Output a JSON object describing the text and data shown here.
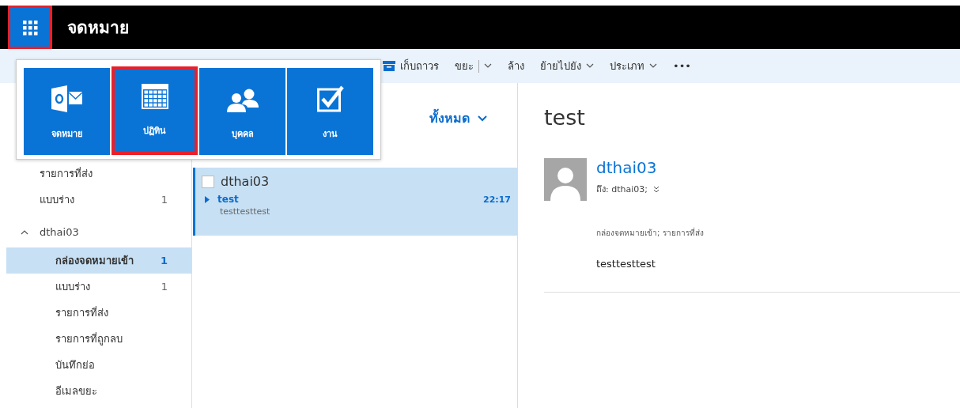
{
  "app_launcher": {
    "highlighted": true
  },
  "header": {
    "title": "จดหมาย"
  },
  "toolbar": [
    {
      "label": "เก็บถาวร",
      "kind": "archive"
    },
    {
      "label": "ขยะ",
      "kind": "split"
    },
    {
      "label": "ล้าง",
      "kind": "plain"
    },
    {
      "label": "ย้ายไปยัง",
      "kind": "dropdown"
    },
    {
      "label": "ประเภท",
      "kind": "dropdown"
    },
    {
      "label": "•••",
      "kind": "plain"
    }
  ],
  "app_menu": [
    {
      "label": "จดหมาย",
      "kind": "mail",
      "highlighted": false
    },
    {
      "label": "ปฏิทิน",
      "kind": "calendar",
      "highlighted": true
    },
    {
      "label": "บุคคล",
      "kind": "people",
      "highlighted": false
    },
    {
      "label": "งาน",
      "kind": "tasks",
      "highlighted": false
    }
  ],
  "favorites": [
    {
      "label": "รายการที่ส่ง",
      "selected": false
    },
    {
      "label": "แบบร่าง",
      "count": "1",
      "selected": false
    }
  ],
  "account": {
    "name": "dthai03",
    "expanded": true,
    "folders": [
      {
        "label": "กล่องจดหมายเข้า",
        "count": "1",
        "selected": true
      },
      {
        "label": "แบบร่าง",
        "count": "1",
        "selected": false
      },
      {
        "label": "รายการที่ส่ง",
        "selected": false
      },
      {
        "label": "รายการที่ถูกลบ",
        "selected": false
      },
      {
        "label": "บันทึกย่อ",
        "selected": false
      },
      {
        "label": "อีเมลขยะ",
        "selected": false
      }
    ]
  },
  "message_list": {
    "filter": "ทั้งหมด",
    "messages": [
      {
        "sender": "dthai03",
        "subject": "test",
        "time": "22:17",
        "preview": "testtesttest",
        "selected": true,
        "checked": false
      }
    ]
  },
  "reading_pane": {
    "subject": "test",
    "sender": "dthai03",
    "to": "ถึง: dthai03;",
    "folders": "กล่องจดหมายเข้า; รายการที่ส่ง",
    "body": "testtesttest"
  }
}
